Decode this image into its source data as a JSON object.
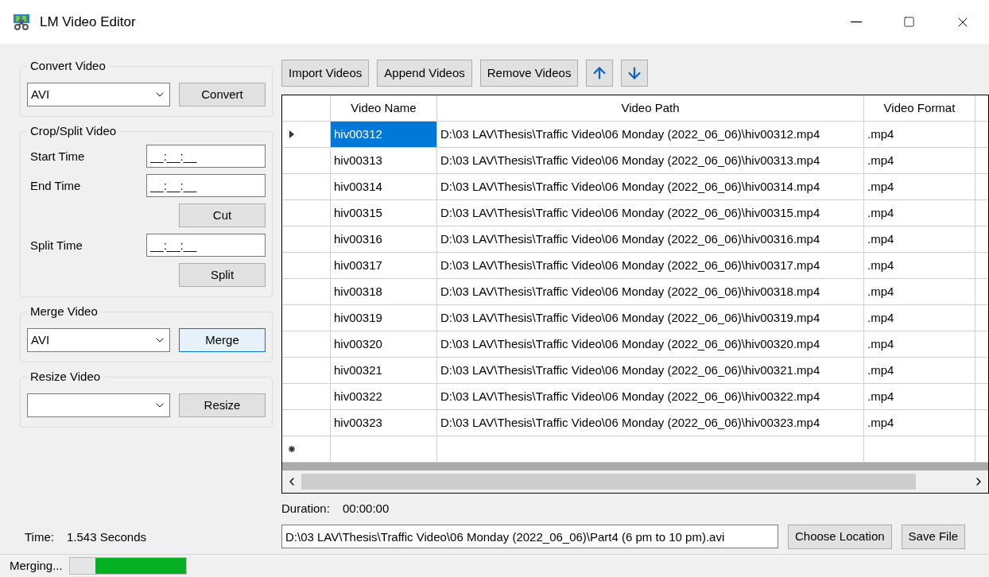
{
  "window": {
    "title": "LM Video Editor"
  },
  "convert": {
    "title": "Convert Video",
    "format": "AVI",
    "button": "Convert"
  },
  "crop": {
    "title": "Crop/Split Video",
    "fields": [
      {
        "label": "Start Time",
        "value": "__:__:__"
      },
      {
        "label": "End Time",
        "value": "__:__:__",
        "button": "Cut"
      },
      {
        "label": "Split Time",
        "value": "__:__:__",
        "button": "Split"
      }
    ]
  },
  "merge": {
    "title": "Merge Video",
    "format": "AVI",
    "button": "Merge",
    "focused": true
  },
  "resize": {
    "title": "Resize Video",
    "button": "Resize"
  },
  "time": {
    "label": "Time:",
    "value": "1.543 Seconds"
  },
  "toolbar": [
    "Import Videos",
    "Append Videos",
    "Remove Videos"
  ],
  "table": {
    "columns": [
      "Video Name",
      "Video Path",
      "Video Format"
    ],
    "rows": [
      {
        "selected": true,
        "cells": [
          "hiv00312",
          "D:\\03 LAV\\Thesis\\Traffic Video\\06 Monday (2022_06_06)\\hiv00312.mp4",
          ".mp4"
        ]
      },
      {
        "selected": false,
        "cells": [
          "hiv00313",
          "D:\\03 LAV\\Thesis\\Traffic Video\\06 Monday (2022_06_06)\\hiv00313.mp4",
          ".mp4"
        ]
      },
      {
        "selected": false,
        "cells": [
          "hiv00314",
          "D:\\03 LAV\\Thesis\\Traffic Video\\06 Monday (2022_06_06)\\hiv00314.mp4",
          ".mp4"
        ]
      },
      {
        "selected": false,
        "cells": [
          "hiv00315",
          "D:\\03 LAV\\Thesis\\Traffic Video\\06 Monday (2022_06_06)\\hiv00315.mp4",
          ".mp4"
        ]
      },
      {
        "selected": false,
        "cells": [
          "hiv00316",
          "D:\\03 LAV\\Thesis\\Traffic Video\\06 Monday (2022_06_06)\\hiv00316.mp4",
          ".mp4"
        ]
      },
      {
        "selected": false,
        "cells": [
          "hiv00317",
          "D:\\03 LAV\\Thesis\\Traffic Video\\06 Monday (2022_06_06)\\hiv00317.mp4",
          ".mp4"
        ]
      },
      {
        "selected": false,
        "cells": [
          "hiv00318",
          "D:\\03 LAV\\Thesis\\Traffic Video\\06 Monday (2022_06_06)\\hiv00318.mp4",
          ".mp4"
        ]
      },
      {
        "selected": false,
        "cells": [
          "hiv00319",
          "D:\\03 LAV\\Thesis\\Traffic Video\\06 Monday (2022_06_06)\\hiv00319.mp4",
          ".mp4"
        ]
      },
      {
        "selected": false,
        "cells": [
          "hiv00320",
          "D:\\03 LAV\\Thesis\\Traffic Video\\06 Monday (2022_06_06)\\hiv00320.mp4",
          ".mp4"
        ]
      },
      {
        "selected": false,
        "cells": [
          "hiv00321",
          "D:\\03 LAV\\Thesis\\Traffic Video\\06 Monday (2022_06_06)\\hiv00321.mp4",
          ".mp4"
        ]
      },
      {
        "selected": false,
        "cells": [
          "hiv00322",
          "D:\\03 LAV\\Thesis\\Traffic Video\\06 Monday (2022_06_06)\\hiv00322.mp4",
          ".mp4"
        ]
      },
      {
        "selected": false,
        "cells": [
          "hiv00323",
          "D:\\03 LAV\\Thesis\\Traffic Video\\06 Monday (2022_06_06)\\hiv00323.mp4",
          ".mp4"
        ]
      }
    ]
  },
  "duration": {
    "label": "Duration:",
    "value": "00:00:00"
  },
  "output": {
    "path": "D:\\03 LAV\\Thesis\\Traffic Video\\06 Monday (2022_06_06)\\Part4 (6 pm to 10 pm).avi",
    "buttons": [
      "Choose Location",
      "Save File"
    ]
  },
  "status_bar": {
    "text": "Merging...",
    "progress": {
      "level": 0.78
    }
  }
}
